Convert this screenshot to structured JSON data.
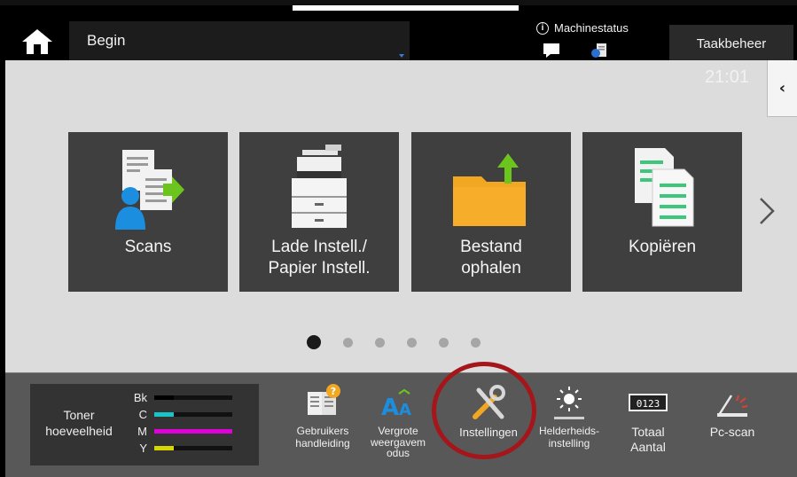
{
  "header": {
    "title": "Begin",
    "machine_status": "Machinestatus",
    "task_button": "Taakbeheer",
    "time": "21:01"
  },
  "tiles": [
    {
      "label_line1": "Scans",
      "label_line2": ""
    },
    {
      "label_line1": "Lade Instell./",
      "label_line2": "Papier Instell."
    },
    {
      "label_line1": "Bestand",
      "label_line2": "ophalen"
    },
    {
      "label_line1": "Kopiëren",
      "label_line2": ""
    }
  ],
  "pager": {
    "pages": 6,
    "active": 1
  },
  "toner": {
    "label_line1": "Toner",
    "label_line2": "hoeveelheid",
    "levels": [
      {
        "key": "Bk",
        "level": 0.25,
        "color": "#000000"
      },
      {
        "key": "C",
        "level": 0.25,
        "color": "#19c3c9"
      },
      {
        "key": "M",
        "level": 1.0,
        "color": "#e000d8"
      },
      {
        "key": "Y",
        "level": 0.25,
        "color": "#d6d600"
      }
    ]
  },
  "tools": [
    {
      "line1": "Gebruikers",
      "line2": "handleiding",
      "line3": ""
    },
    {
      "line1": "Vergrote",
      "line2": "weergavem",
      "line3": "odus"
    },
    {
      "line1": "Instellingen",
      "line2": "",
      "line3": ""
    },
    {
      "line1": "Helderheids-",
      "line2": "instelling",
      "line3": ""
    },
    {
      "line1": "Totaal",
      "line2": "Aantal",
      "line3": ""
    },
    {
      "line1": "Pc-scan",
      "line2": "",
      "line3": ""
    }
  ],
  "counter_digits": "0123",
  "colors": {
    "highlight_circle": "#a4161a",
    "accent_green": "#6cc51c",
    "folder": "#f2a723"
  }
}
